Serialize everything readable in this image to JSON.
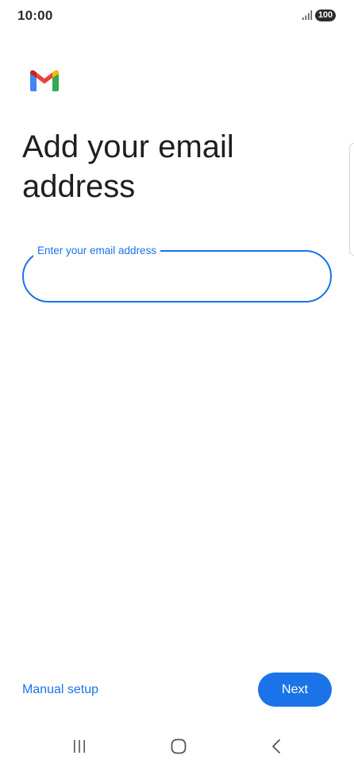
{
  "status_bar": {
    "time": "10:00",
    "battery": "100",
    "signal_icon": "signal-bars-icon"
  },
  "app": {
    "logo_icon": "gmail-logo-icon"
  },
  "page": {
    "title": "Add your email address"
  },
  "email_input": {
    "label": "Enter your email address",
    "value": "",
    "placeholder": ""
  },
  "actions": {
    "manual_setup_label": "Manual setup",
    "next_label": "Next"
  },
  "nav_bar": {
    "recents_icon": "recents-icon",
    "home_icon": "home-icon",
    "back_icon": "back-icon"
  },
  "colors": {
    "accent": "#1a73e8",
    "text": "#1f1f1f",
    "background": "#ffffff"
  }
}
